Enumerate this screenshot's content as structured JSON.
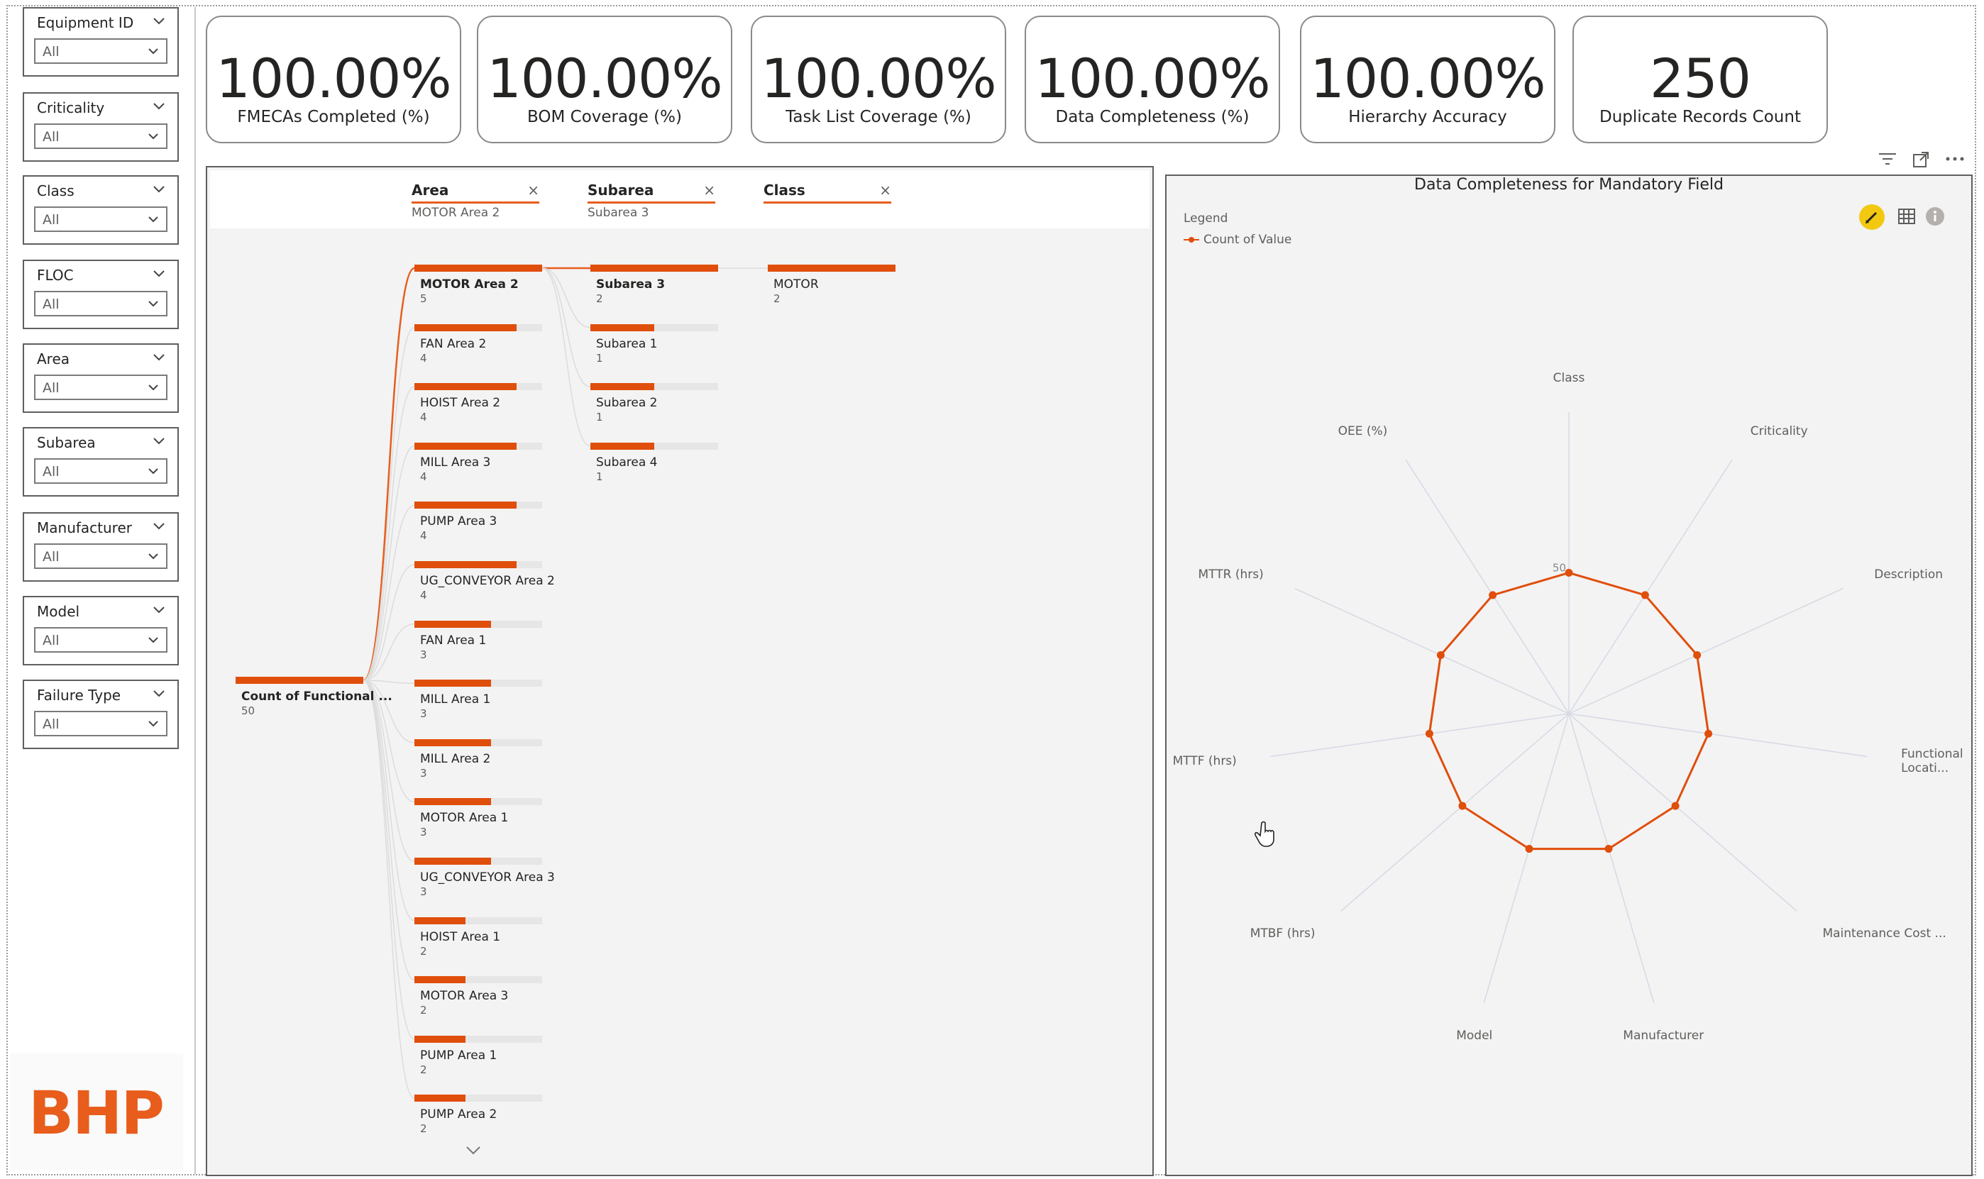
{
  "slicers": [
    {
      "title": "Equipment ID",
      "value": "All"
    },
    {
      "title": "Criticality",
      "value": "All"
    },
    {
      "title": "Class",
      "value": "All"
    },
    {
      "title": "FLOC",
      "value": "All"
    },
    {
      "title": "Area",
      "value": "All"
    },
    {
      "title": "Subarea",
      "value": "All"
    },
    {
      "title": "Manufacturer",
      "value": "All"
    },
    {
      "title": "Model",
      "value": "All"
    },
    {
      "title": "Failure Type",
      "value": "All"
    }
  ],
  "logo": "BHP",
  "kpis": [
    {
      "value": "100.00%",
      "label": "FMECAs Completed (%)"
    },
    {
      "value": "100.00%",
      "label": "BOM Coverage (%)"
    },
    {
      "value": "100.00%",
      "label": "Task List Coverage (%)"
    },
    {
      "value": "100.00%",
      "label": "Data Completeness (%)"
    },
    {
      "value": "100.00%",
      "label": "Hierarchy Accuracy"
    },
    {
      "value": "250",
      "label": "Duplicate Records Count"
    }
  ],
  "tree": {
    "levels": [
      {
        "name": "Area",
        "selected": "MOTOR Area 2",
        "close": "×"
      },
      {
        "name": "Subarea",
        "selected": "Subarea 3",
        "close": "×"
      },
      {
        "name": "Class",
        "selected": "",
        "close": "×"
      }
    ],
    "root": {
      "label": "Count of Functional ...",
      "value": 50
    },
    "areas": [
      {
        "label": "MOTOR Area 2",
        "value": 5
      },
      {
        "label": "FAN Area 2",
        "value": 4
      },
      {
        "label": "HOIST Area 2",
        "value": 4
      },
      {
        "label": "MILL Area 3",
        "value": 4
      },
      {
        "label": "PUMP Area 3",
        "value": 4
      },
      {
        "label": "UG_CONVEYOR Area 2",
        "value": 4
      },
      {
        "label": "FAN Area 1",
        "value": 3
      },
      {
        "label": "MILL Area 1",
        "value": 3
      },
      {
        "label": "MILL Area 2",
        "value": 3
      },
      {
        "label": "MOTOR Area 1",
        "value": 3
      },
      {
        "label": "UG_CONVEYOR Area 3",
        "value": 3
      },
      {
        "label": "HOIST Area 1",
        "value": 2
      },
      {
        "label": "MOTOR Area 3",
        "value": 2
      },
      {
        "label": "PUMP Area 1",
        "value": 2
      },
      {
        "label": "PUMP Area 2",
        "value": 2
      }
    ],
    "subareas": [
      {
        "label": "Subarea 3",
        "value": 2
      },
      {
        "label": "Subarea 1",
        "value": 1
      },
      {
        "label": "Subarea 2",
        "value": 1
      },
      {
        "label": "Subarea 4",
        "value": 1
      }
    ],
    "classes": [
      {
        "label": "MOTOR",
        "value": 2
      }
    ]
  },
  "radar": {
    "title": "Data Completeness for Mandatory Field",
    "legend_title": "Legend",
    "legend_item": "Count of Value",
    "series_color": "#e04e0c",
    "grid_label": "50"
  },
  "chart_data": {
    "type": "radar",
    "title": "Data Completeness for Mandatory Field",
    "categories": [
      "Class",
      "Criticality",
      "Description",
      "Functional Locati...",
      "Maintenance Cost ...",
      "Manufacturer",
      "Model",
      "MTBF (hrs)",
      "MTTF (hrs)",
      "MTTR (hrs)",
      "OEE (%)"
    ],
    "series": [
      {
        "name": "Count of Value",
        "values": [
          50,
          50,
          50,
          50,
          50,
          50,
          50,
          50,
          50,
          50,
          50
        ]
      }
    ],
    "rlim": [
      0,
      107
    ],
    "grid_tick": 50,
    "legend": "top-left"
  }
}
